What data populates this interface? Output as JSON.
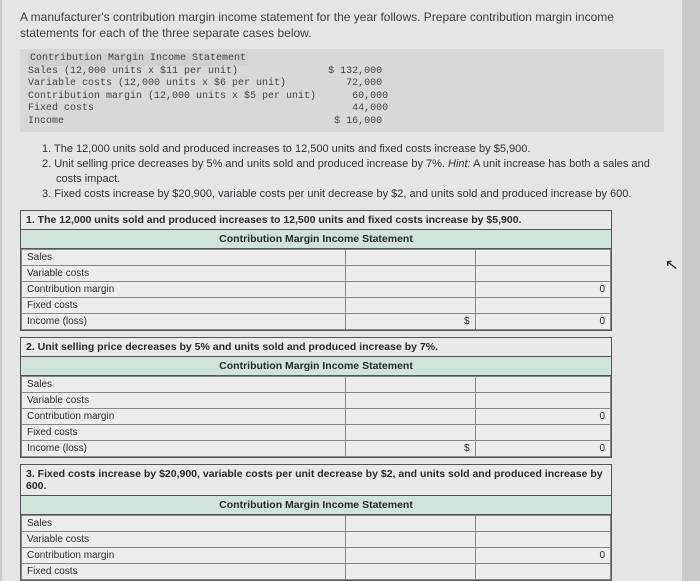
{
  "prompt": "A manufacturer's contribution margin income statement for the year follows. Prepare contribution margin income statements for each of the three separate cases below.",
  "given": {
    "title": "Contribution Margin Income Statement",
    "r1l": "Sales (12,000 units x $11 per unit)",
    "r1v": "$ 132,000",
    "r2l": "Variable costs (12,000 units x $6 per unit)",
    "r2v": "72,000",
    "r3l": "Contribution margin (12,000 units x $5 per unit)",
    "r3v": "60,000",
    "r4l": "Fixed costs",
    "r4v": "44,000",
    "r5l": "Income",
    "r5v": "$ 16,000"
  },
  "cases_text": {
    "c1": "1. The 12,000 units sold and produced increases to 12,500 units and fixed costs increase by $5,900.",
    "c2a": "2. Unit selling price decreases by 5% and units sold and produced increase by 7%. ",
    "c2hint": "Hint:",
    "c2b": " A unit increase has both a sales and costs impact.",
    "c3": "3. Fixed costs increase by $20,900, variable costs per unit decrease by $2, and units sold and produced increase by 600."
  },
  "subhead": "Contribution Margin Income Statement",
  "rows": {
    "sales": "Sales",
    "var": "Variable costs",
    "cm": "Contribution margin",
    "fixed": "Fixed costs",
    "inc": "Income (loss)"
  },
  "case1_title": "1. The 12,000 units sold and produced increases to 12,500 units and fixed costs increase by $5,900.",
  "case2_title": "2. Unit selling price decreases by 5% and units sold and produced increase by 7%.",
  "case3_title": "3. Fixed costs increase by $20,900, variable costs per unit decrease by $2, and units sold and produced increase by 600.",
  "zero": "0",
  "dollar": "$",
  "chart_data": {
    "type": "table",
    "base": {
      "units": 12000,
      "price": 11,
      "var_cost_per_unit": 6,
      "sales": 132000,
      "variable_costs": 72000,
      "contribution_margin": 60000,
      "fixed_costs": 44000,
      "income": 16000
    },
    "scenarios": [
      {
        "id": 1,
        "units": 12500,
        "fixed_cost_change": 5900
      },
      {
        "id": 2,
        "price_change_pct": -5,
        "units_change_pct": 7
      },
      {
        "id": 3,
        "fixed_cost_change": 20900,
        "var_cost_per_unit_change": -2,
        "units_change": 600
      }
    ]
  }
}
